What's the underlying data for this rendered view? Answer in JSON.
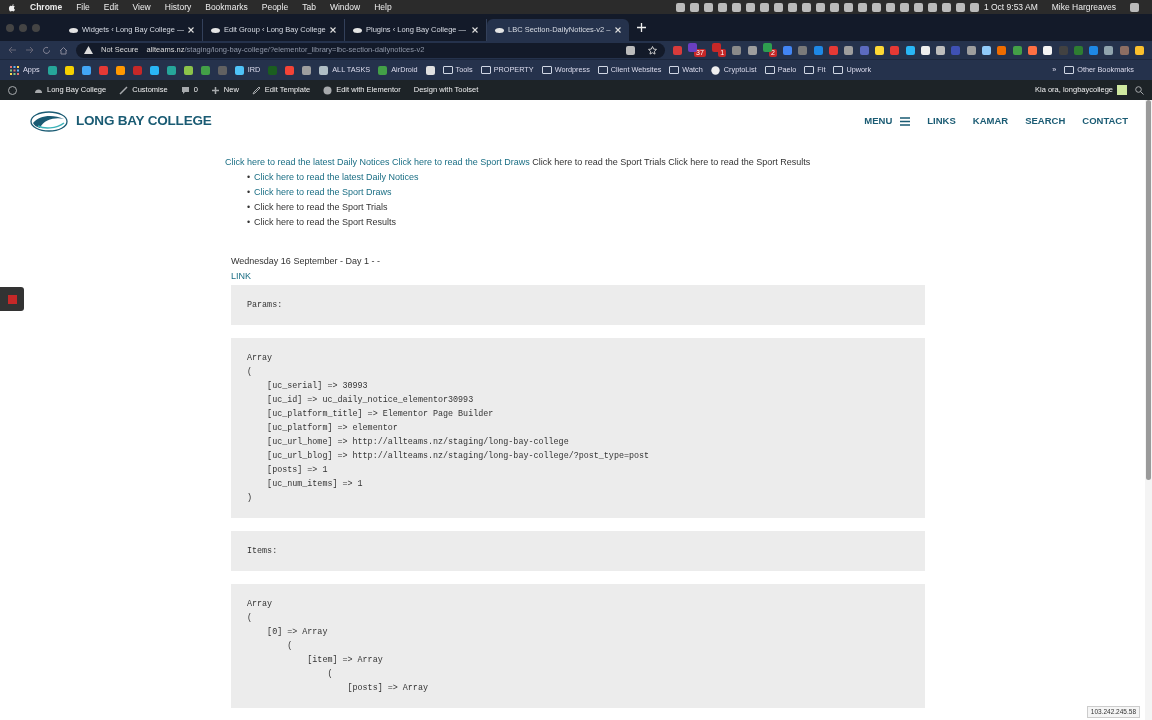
{
  "menu_bar": {
    "app": "Chrome",
    "items": [
      "File",
      "Edit",
      "View",
      "History",
      "Bookmarks",
      "People",
      "Tab",
      "Window",
      "Help"
    ],
    "date": "1 Oct",
    "time": "9:53 AM",
    "user": "Mike Hargreaves"
  },
  "tabs": [
    {
      "title": "Widgets ‹ Long Bay College —",
      "selected": false
    },
    {
      "title": "Edit Group ‹ Long Bay College",
      "selected": false
    },
    {
      "title": "Plugins ‹ Long Bay College —",
      "selected": false
    },
    {
      "title": "LBC Section-DailyNotices-v2 –",
      "selected": true
    }
  ],
  "address_bar": {
    "security": "Not Secure",
    "host": "allteams.nz",
    "path": "/staging/long-bay-college/?elementor_library=lbc-section-dailynotices-v2"
  },
  "extensions": [
    {
      "color": "#d83b3b"
    },
    {
      "color": "#6a3fc1",
      "badge": "37"
    },
    {
      "color": "#c62828",
      "badge": "1"
    },
    {
      "color": "#8a8a8a"
    },
    {
      "color": "#9e9e9e"
    },
    {
      "color": "#2e9e4f",
      "badge": "2"
    },
    {
      "color": "#4285f4"
    },
    {
      "color": "#7a7a7a"
    },
    {
      "color": "#1e88e5"
    },
    {
      "color": "#e53935"
    },
    {
      "color": "#9e9e9e"
    },
    {
      "color": "#5c6bc0"
    },
    {
      "color": "#fdd835"
    },
    {
      "color": "#e53935"
    },
    {
      "color": "#29b6f6"
    },
    {
      "color": "#eeeeee"
    },
    {
      "color": "#bdbdbd"
    },
    {
      "color": "#3f51b5"
    },
    {
      "color": "#9e9e9e"
    },
    {
      "color": "#90caf9"
    },
    {
      "color": "#ef6c00"
    },
    {
      "color": "#43a047"
    },
    {
      "color": "#ff7043"
    },
    {
      "color": "#f5f5f5"
    },
    {
      "color": "#424242"
    },
    {
      "color": "#2e7d32"
    },
    {
      "color": "#1e88e5"
    },
    {
      "color": "#90a4ae"
    },
    {
      "color": "#8d6e63"
    },
    {
      "color": "#fbc02d"
    }
  ],
  "bookmarks": [
    {
      "kind": "apps",
      "label": "Apps"
    },
    {
      "kind": "icon",
      "color": "#26a69a"
    },
    {
      "kind": "icon",
      "color": "#f5d000"
    },
    {
      "kind": "icon",
      "color": "#42a5f5"
    },
    {
      "kind": "icon",
      "color": "#e53935"
    },
    {
      "kind": "icon",
      "color": "#ff9800"
    },
    {
      "kind": "icon",
      "color": "#c62828"
    },
    {
      "kind": "icon",
      "color": "#29b6f6"
    },
    {
      "kind": "icon",
      "color": "#26a69a"
    },
    {
      "kind": "icon",
      "color": "#8bc34a"
    },
    {
      "kind": "icon",
      "color": "#43a047"
    },
    {
      "kind": "icon",
      "color": "#616161"
    },
    {
      "kind": "link",
      "label": "IRD",
      "color": "#4fc3f7"
    },
    {
      "kind": "icon",
      "color": "#1b5e20"
    },
    {
      "kind": "icon",
      "color": "#f44336"
    },
    {
      "kind": "icon",
      "color": "#9e9e9e"
    },
    {
      "kind": "link",
      "label": "ALL TASKS",
      "color": "#b0bec5"
    },
    {
      "kind": "link",
      "label": "AirDroid",
      "color": "#43a047"
    },
    {
      "kind": "icon",
      "color": "#e0e0e0"
    },
    {
      "kind": "folder",
      "label": "Tools"
    },
    {
      "kind": "folder",
      "label": "PROPERTY"
    },
    {
      "kind": "folder",
      "label": "Wordpress"
    },
    {
      "kind": "folder",
      "label": "Client Websites"
    },
    {
      "kind": "folder",
      "label": "Watch"
    },
    {
      "kind": "github",
      "label": "CryptoList"
    },
    {
      "kind": "folder",
      "label": "Paelo"
    },
    {
      "kind": "folder",
      "label": "Fit"
    },
    {
      "kind": "folder",
      "label": "Upwork"
    },
    {
      "kind": "more",
      "label": "»"
    },
    {
      "kind": "folder",
      "label": "Other Bookmarks"
    }
  ],
  "admin_bar": {
    "items": [
      {
        "kind": "wp"
      },
      {
        "kind": "site",
        "label": "Long Bay College"
      },
      {
        "kind": "brush",
        "label": "Customise"
      },
      {
        "kind": "comments",
        "label": "0"
      },
      {
        "kind": "new",
        "label": "New"
      },
      {
        "kind": "pencil",
        "label": "Edit Template"
      },
      {
        "kind": "elementor",
        "label": "Edit with Elementor"
      },
      {
        "kind": "text",
        "label": "Design with Toolset"
      }
    ],
    "greeting": "Kia ora, longbaycollege"
  },
  "site_header": {
    "logo_text": "LONG BAY COLLEGE",
    "nav": [
      {
        "label": "MENU",
        "kind": "menu"
      },
      {
        "label": "LINKS",
        "kind": "link"
      },
      {
        "label": "KAMAR",
        "kind": "link"
      },
      {
        "label": "SEARCH",
        "kind": "link"
      },
      {
        "label": "CONTACT",
        "kind": "link"
      }
    ]
  },
  "notice_links_inline": [
    {
      "text": "Click here to read the latest Daily Notices",
      "linked": true
    },
    {
      "text": "Click here to read the Sport Draws",
      "linked": true
    },
    {
      "text": "Click here to read the Sport Trials",
      "linked": false
    },
    {
      "text": "Click here to read the Sport Results",
      "linked": false
    }
  ],
  "notice_links_list": [
    {
      "marker": "•",
      "text": "Click here to read the latest Daily Notices",
      "linked": true
    },
    {
      "marker": "•",
      "text": "Click here to read the Sport Draws",
      "linked": true
    },
    {
      "marker": "•",
      "text": "Click here to read the Sport Trials",
      "linked": false
    },
    {
      "marker": "•",
      "text": "Click here to read the Sport Results",
      "linked": false
    }
  ],
  "date_line": "Wednesday 16 September - Day 1 - -",
  "link": "LINK",
  "code_blocks": [
    "Params:",
    "Array\n(\n    [uc_serial] => 30993\n    [uc_id] => uc_daily_notice_elementor30993\n    [uc_platform_title] => Elementor Page Builder\n    [uc_platform] => elementor\n    [uc_url_home] => http://allteams.nz/staging/long-bay-college\n    [uc_url_blog] => http://allteams.nz/staging/long-bay-college/?post_type=post\n    [posts] => 1\n    [uc_num_items] => 1\n)",
    "Items:",
    "Array\n(\n    [0] => Array\n        (\n            [item] => Array\n                (\n                    [posts] => Array"
  ],
  "ip_badge": "103.242.245.58"
}
